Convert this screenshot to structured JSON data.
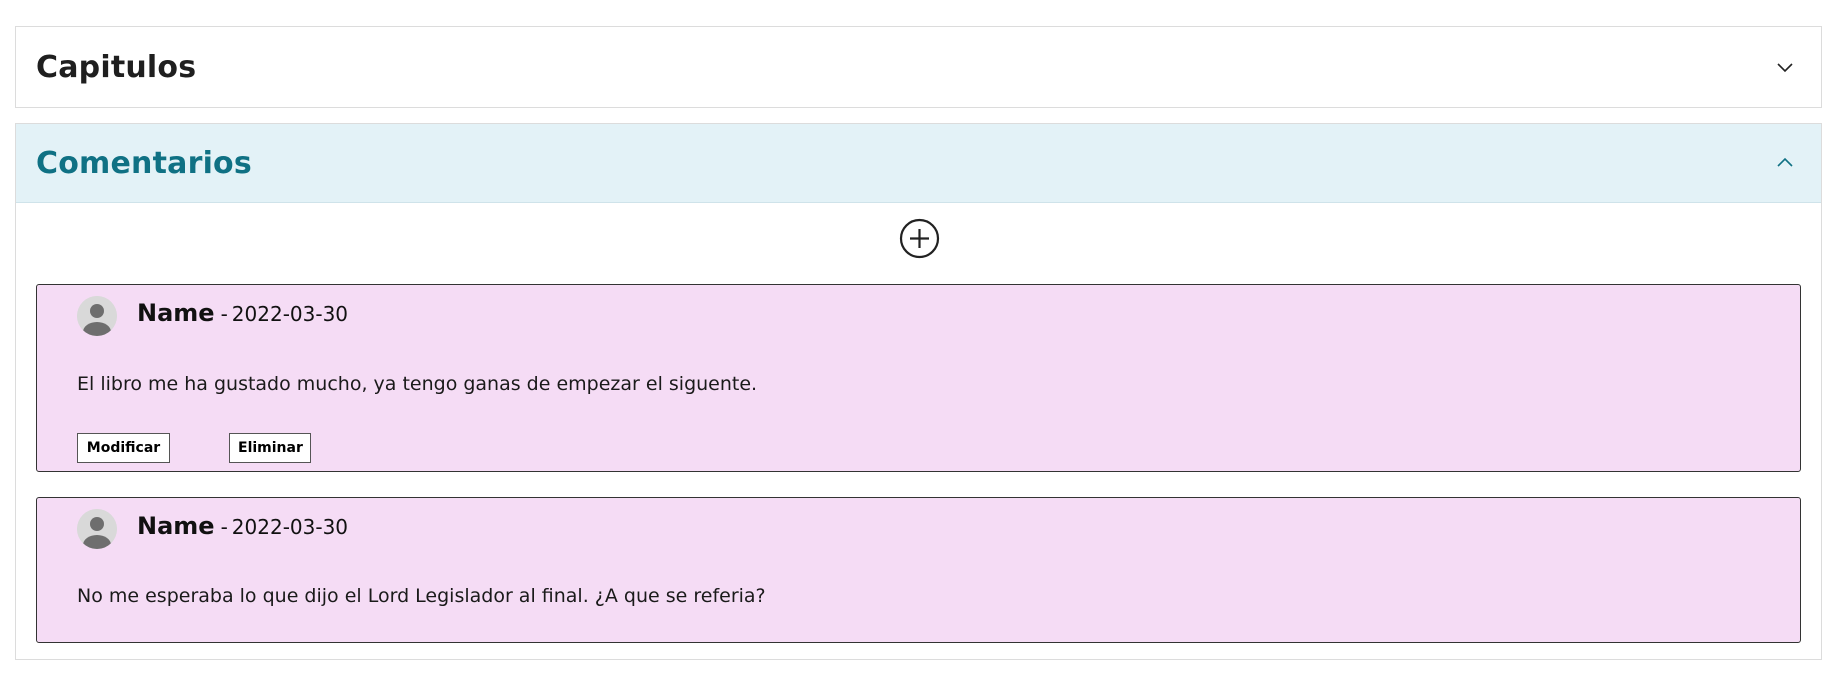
{
  "sections": {
    "capitulos": {
      "title": "Capitulos",
      "expanded": false,
      "icon": "chevron-down-icon"
    },
    "comentarios": {
      "title": "Comentarios",
      "expanded": true,
      "icon": "chevron-up-icon",
      "accent_color": "#0f7184",
      "header_bg": "#e3f2f7"
    }
  },
  "add_comment": {
    "icon": "add-circle-icon"
  },
  "comments": [
    {
      "author": "Name",
      "separator": "-",
      "date": "2022-03-30",
      "text": "El libro me ha gustado mucho, ya tengo ganas de empezar el siguente.",
      "actions": {
        "modify_label": "Modificar",
        "delete_label": "Eliminar"
      },
      "card_bg": "#f5dcf5"
    },
    {
      "author": "Name",
      "separator": "-",
      "date": "2022-03-30",
      "text": "No me esperaba lo que dijo el Lord Legislador al final. ¿A que se referia?",
      "card_bg": "#f5dcf5"
    }
  ]
}
